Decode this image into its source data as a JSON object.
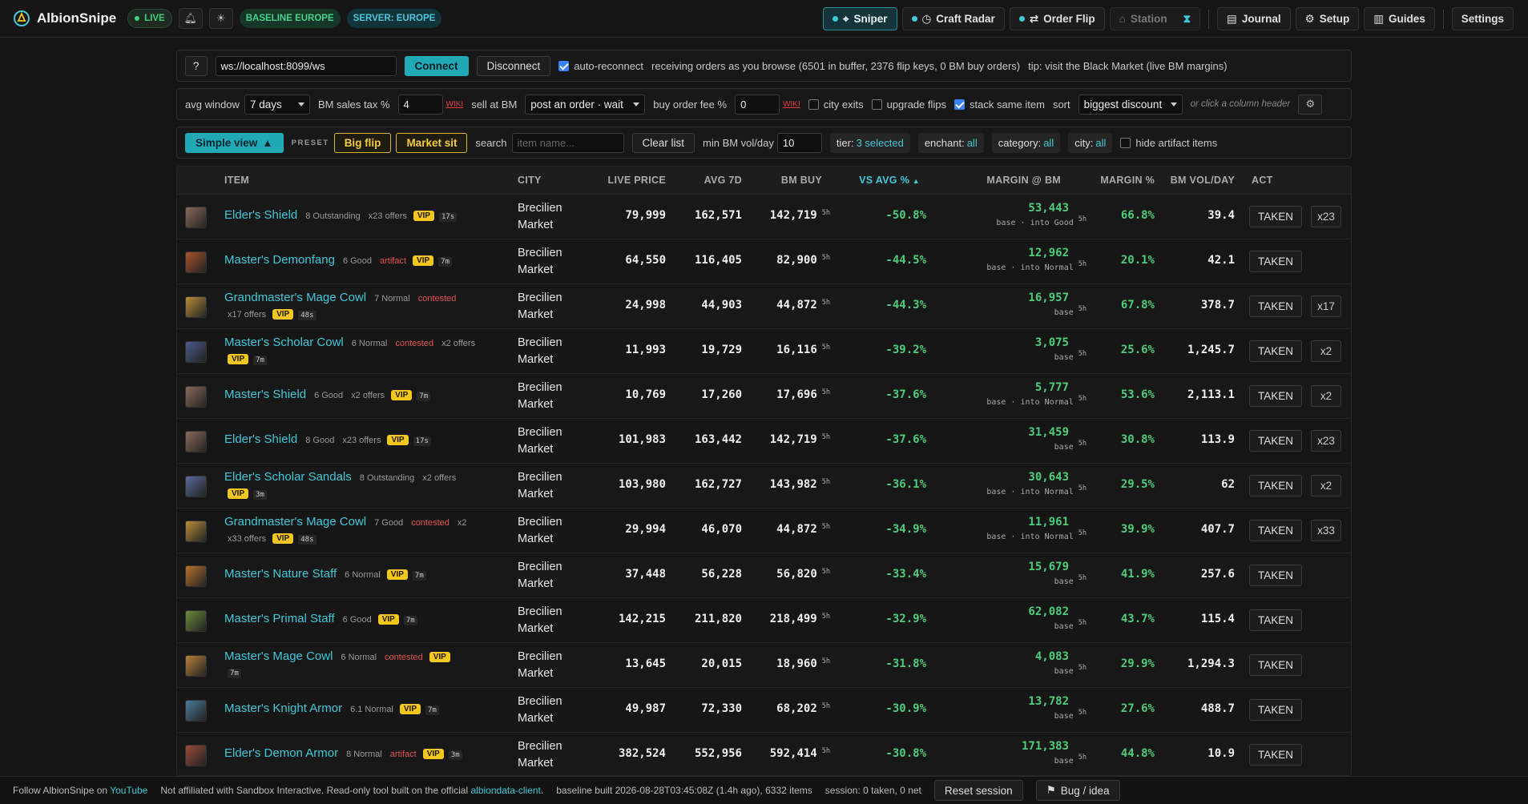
{
  "app": {
    "name": "AlbionSnipe",
    "live": "LIVE",
    "baseline": "BASELINE EUROPE",
    "server": "SERVER: EUROPE"
  },
  "nav": {
    "sniper": "Sniper",
    "craft_radar": "Craft Radar",
    "order_flip": "Order Flip",
    "station": "Station",
    "journal": "Journal",
    "setup": "Setup",
    "guides": "Guides",
    "settings": "Settings"
  },
  "conn": {
    "help": "?",
    "ws_url": "ws://localhost:8099/ws",
    "connect": "Connect",
    "disconnect": "Disconnect",
    "auto_reconnect": "auto-reconnect",
    "status": "receiving orders as you browse (6501 in buffer, 2376 flip keys, 0 BM buy orders)",
    "tip": "tip: visit the Black Market (live BM margins)"
  },
  "opts": {
    "avg_window_label": "avg window",
    "avg_window": "7 days",
    "tax_label": "BM sales tax %",
    "tax": "4",
    "wiki": "WIKI",
    "sell_label": "sell at BM",
    "sell": "post an order · wait",
    "fee_label": "buy order fee %",
    "fee": "0",
    "city_exits": "city exits",
    "upgrade_flips": "upgrade flips",
    "stack_same": "stack same item",
    "sort_label": "sort",
    "sort": "biggest discount",
    "sort_hint": "or click a column header"
  },
  "filters": {
    "view": "Simple view",
    "preset": "PRESET",
    "big_flip": "Big flip",
    "market_sit": "Market sit",
    "search_label": "search",
    "search_ph": "item name...",
    "clear": "Clear list",
    "min_vol_label": "min BM vol/day",
    "min_vol": "10",
    "tier": "tier:",
    "tier_val": "3 selected",
    "enchant": "enchant:",
    "enchant_val": "all",
    "category": "category:",
    "category_val": "all",
    "city": "city:",
    "city_val": "all",
    "hide_artifact": "hide artifact items"
  },
  "headers": {
    "item": "ITEM",
    "city": "CITY",
    "live": "LIVE PRICE",
    "avg": "AVG 7D",
    "bm": "BM BUY",
    "vs": "VS AVG %",
    "margin": "MARGIN @ BM",
    "marginp": "MARGIN %",
    "vol": "BM VOL/DAY",
    "act": "ACT"
  },
  "colors": {
    "accent": "#3ec8d8",
    "green": "#4ccd7a",
    "vip": "#f2c81f",
    "red": "#e35252"
  },
  "rows": [
    {
      "name": "Elder's Shield",
      "ico": "#8a6a5a",
      "l1": [
        "8 Outstanding",
        "x23 offers"
      ],
      "red": "",
      "vip": "VIP",
      "age": "17s",
      "l2": [],
      "city": "Brecilien Market",
      "live": "79,999",
      "avg": "162,571",
      "bm": "142,719",
      "bmsup": "5h",
      "vs": "-50.8%",
      "margin": "53,443",
      "mbase": "base · ",
      "minto": "into Good",
      "msup": "5h",
      "mp": "66.8%",
      "vol": "39.4",
      "act": "TAKEN",
      "x": "x23"
    },
    {
      "name": "Master's Demonfang",
      "ico": "#a8522a",
      "l1": [
        "6 Good"
      ],
      "red": "artifact",
      "vip": "VIP",
      "age": "7m",
      "l2": [],
      "city": "Brecilien Market",
      "live": "64,550",
      "avg": "116,405",
      "bm": "82,900",
      "bmsup": "5h",
      "vs": "-44.5%",
      "margin": "12,962",
      "mbase": "base · ",
      "minto": "into Normal",
      "msup": "5h",
      "mp": "20.1%",
      "vol": "42.1",
      "act": "TAKEN",
      "x": ""
    },
    {
      "name": "Grandmaster's Mage Cowl",
      "ico": "#b88d3a",
      "l1": [
        "7 Normal"
      ],
      "red": "contested",
      "vip": "",
      "age": "",
      "l2line": "x17 offers",
      "l2vip": "VIP",
      "l2age": "48s",
      "city": "Brecilien Market",
      "live": "24,998",
      "avg": "44,903",
      "bm": "44,872",
      "bmsup": "5h",
      "vs": "-44.3%",
      "margin": "16,957",
      "mbase": "base",
      "minto": "",
      "msup": "5h",
      "mp": "67.8%",
      "vol": "378.7",
      "act": "TAKEN",
      "x": "x17"
    },
    {
      "name": "Master's Scholar Cowl",
      "ico": "#4a5a8a",
      "l1": [
        "6 Normal"
      ],
      "red": "contested",
      "extra": "x2 offers",
      "vip": "",
      "age": "",
      "l2line": "",
      "l2vip": "VIP",
      "l2age": "7m",
      "city": "Brecilien Market",
      "live": "11,993",
      "avg": "19,729",
      "bm": "16,116",
      "bmsup": "5h",
      "vs": "-39.2%",
      "margin": "3,075",
      "mbase": "base",
      "minto": "",
      "msup": "5h",
      "mp": "25.6%",
      "vol": "1,245.7",
      "act": "TAKEN",
      "x": "x2"
    },
    {
      "name": "Master's Shield",
      "ico": "#8a6a5a",
      "l1": [
        "6 Good",
        "x2 offers"
      ],
      "red": "",
      "vip": "VIP",
      "age": "7m",
      "l2": [],
      "city": "Brecilien Market",
      "live": "10,769",
      "avg": "17,260",
      "bm": "17,696",
      "bmsup": "5h",
      "vs": "-37.6%",
      "margin": "5,777",
      "mbase": "base · ",
      "minto": "into Normal",
      "msup": "5h",
      "mp": "53.6%",
      "vol": "2,113.1",
      "act": "TAKEN",
      "x": "x2"
    },
    {
      "name": "Elder's Shield",
      "ico": "#8a6a5a",
      "l1": [
        "8 Good",
        "x23 offers"
      ],
      "red": "",
      "vip": "VIP",
      "age": "17s",
      "l2": [],
      "city": "Brecilien Market",
      "live": "101,983",
      "avg": "163,442",
      "bm": "142,719",
      "bmsup": "5h",
      "vs": "-37.6%",
      "margin": "31,459",
      "mbase": "base",
      "minto": "",
      "msup": "5h",
      "mp": "30.8%",
      "vol": "113.9",
      "act": "TAKEN",
      "x": "x23"
    },
    {
      "name": "Elder's Scholar Sandals",
      "ico": "#5a6a9a",
      "l1": [
        "8 Outstanding",
        "x2 offers"
      ],
      "red": "",
      "vip": "",
      "age": "",
      "l2line": "",
      "l2vip": "VIP",
      "l2age": "3m",
      "city": "Brecilien Market",
      "live": "103,980",
      "avg": "162,727",
      "bm": "143,982",
      "bmsup": "5h",
      "vs": "-36.1%",
      "margin": "30,643",
      "mbase": "base · ",
      "minto": "into Normal",
      "msup": "5h",
      "mp": "29.5%",
      "vol": "62",
      "act": "TAKEN",
      "x": "x2"
    },
    {
      "name": "Grandmaster's Mage Cowl",
      "ico": "#b88d3a",
      "l1": [
        "7 Good"
      ],
      "red": "contested",
      "extra": "x2",
      "vip": "",
      "age": "",
      "l2line": "x33 offers",
      "l2vip": "VIP",
      "l2age": "48s",
      "city": "Brecilien Market",
      "live": "29,994",
      "avg": "46,070",
      "bm": "44,872",
      "bmsup": "5h",
      "vs": "-34.9%",
      "margin": "11,961",
      "mbase": "base · ",
      "minto": "into Normal",
      "msup": "5h",
      "mp": "39.9%",
      "vol": "407.7",
      "act": "TAKEN",
      "x": "x33"
    },
    {
      "name": "Master's Nature Staff",
      "ico": "#b8702a",
      "l1": [
        "6 Normal"
      ],
      "red": "",
      "vip": "VIP",
      "age": "7m",
      "l2": [],
      "city": "Brecilien Market",
      "live": "37,448",
      "avg": "56,228",
      "bm": "56,820",
      "bmsup": "5h",
      "vs": "-33.4%",
      "margin": "15,679",
      "mbase": "base",
      "minto": "",
      "msup": "5h",
      "mp": "41.9%",
      "vol": "257.6",
      "act": "TAKEN",
      "x": ""
    },
    {
      "name": "Master's Primal Staff",
      "ico": "#6a8a3a",
      "l1": [
        "6 Good"
      ],
      "red": "",
      "vip": "VIP",
      "age": "7m",
      "l2": [],
      "city": "Brecilien Market",
      "live": "142,215",
      "avg": "211,820",
      "bm": "218,499",
      "bmsup": "5h",
      "vs": "-32.9%",
      "margin": "62,082",
      "mbase": "base",
      "minto": "",
      "msup": "5h",
      "mp": "43.7%",
      "vol": "115.4",
      "act": "TAKEN",
      "x": ""
    },
    {
      "name": "Master's Mage Cowl",
      "ico": "#b8803a",
      "l1": [
        "6 Normal"
      ],
      "red": "contested",
      "vip": "VIP",
      "age": "",
      "l2line": "",
      "l2vip": "",
      "l2age": "7m",
      "city": "Brecilien Market",
      "live": "13,645",
      "avg": "20,015",
      "bm": "18,960",
      "bmsup": "5h",
      "vs": "-31.8%",
      "margin": "4,083",
      "mbase": "base",
      "minto": "",
      "msup": "5h",
      "mp": "29.9%",
      "vol": "1,294.3",
      "act": "TAKEN",
      "x": ""
    },
    {
      "name": "Master's Knight Armor",
      "ico": "#4a7a9a",
      "l1": [
        "6.1 Normal"
      ],
      "red": "",
      "vip": "VIP",
      "age": "7m",
      "l2": [],
      "city": "Brecilien Market",
      "live": "49,987",
      "avg": "72,330",
      "bm": "68,202",
      "bmsup": "5h",
      "vs": "-30.9%",
      "margin": "13,782",
      "mbase": "base",
      "minto": "",
      "msup": "5h",
      "mp": "27.6%",
      "vol": "488.7",
      "act": "TAKEN",
      "x": ""
    },
    {
      "name": "Elder's Demon Armor",
      "ico": "#9a4a3a",
      "l1": [
        "8 Normal"
      ],
      "red": "artifact",
      "vip": "VIP",
      "age": "3m",
      "l2": [],
      "city": "Brecilien Market",
      "live": "382,524",
      "avg": "552,956",
      "bm": "592,414",
      "bmsup": "5h",
      "vs": "-30.8%",
      "margin": "171,383",
      "mbase": "base",
      "minto": "",
      "msup": "5h",
      "mp": "44.8%",
      "vol": "10.9",
      "act": "TAKEN",
      "x": ""
    }
  ],
  "footer": {
    "follow": "Follow AlbionSnipe on",
    "youtube": "YouTube",
    "affil": "Not affiliated with Sandbox Interactive. Read-only tool built on the official",
    "client": "albiondata-client",
    "affil_end": ".",
    "baseline": "baseline built 2026-08-28T03:45:08Z (1.4h ago), 6332 items",
    "session": "session: 0 taken, 0 net",
    "reset": "Reset session",
    "bug": "Bug / idea"
  }
}
